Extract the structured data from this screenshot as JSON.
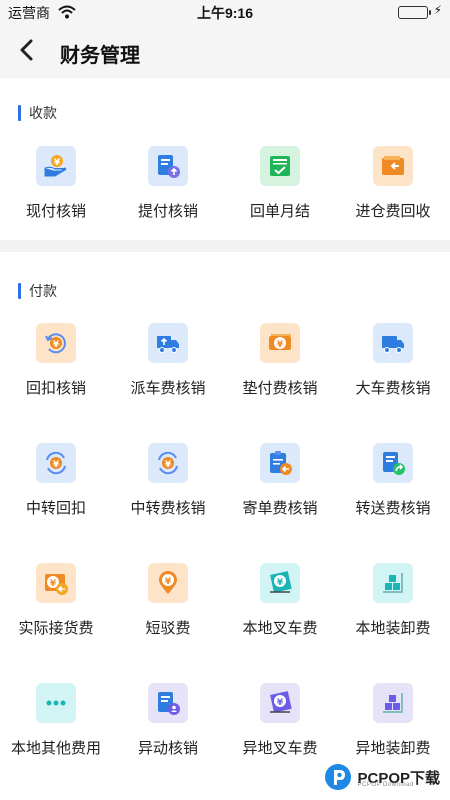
{
  "status_bar": {
    "carrier": "运营商",
    "time": "上午9:16",
    "wifi_icon": "wifi-icon",
    "battery_icon": "battery-icon",
    "battery_level": 1.0,
    "charging_icon": "charging-bolt-icon"
  },
  "nav": {
    "back_icon": "chevron-left-icon",
    "title": "财务管理"
  },
  "sections": [
    {
      "title": "收款",
      "items": [
        {
          "label": "现付核销",
          "icon": "cash-hand-icon",
          "color": "#2f7de1"
        },
        {
          "label": "提付核销",
          "icon": "document-upload-icon",
          "color": "#2f7de1"
        },
        {
          "label": "回单月结",
          "icon": "receipt-check-icon",
          "color": "#1fb65a"
        },
        {
          "label": "进仓费回收",
          "icon": "wallet-return-icon",
          "color": "#f08a24"
        }
      ]
    },
    {
      "title": "付款",
      "items": [
        {
          "label": "回扣核销",
          "icon": "yuan-cycle-icon",
          "color": "#f08a24"
        },
        {
          "label": "派车费核销",
          "icon": "truck-upload-icon",
          "color": "#2f7de1"
        },
        {
          "label": "垫付费核销",
          "icon": "money-stack-icon",
          "color": "#f08a24"
        },
        {
          "label": "大车费核销",
          "icon": "truck-icon",
          "color": "#2f7de1"
        },
        {
          "label": "中转回扣",
          "icon": "yuan-transfer-icon",
          "color": "#2f7de1"
        },
        {
          "label": "中转费核销",
          "icon": "yuan-transfer-icon",
          "color": "#2f7de1"
        },
        {
          "label": "寄单费核销",
          "icon": "clipboard-send-icon",
          "color": "#2f7de1"
        },
        {
          "label": "转送费核销",
          "icon": "document-forward-icon",
          "color": "#2f7de1"
        },
        {
          "label": "实际接货费",
          "icon": "wallet-yuan-icon",
          "color": "#f08a24"
        },
        {
          "label": "短驳费",
          "icon": "yuan-location-pin-icon",
          "color": "#f08a24"
        },
        {
          "label": "本地叉车费",
          "icon": "forklift-yuan-icon",
          "color": "#1bb5b5"
        },
        {
          "label": "本地装卸费",
          "icon": "boxes-cart-icon",
          "color": "#1bb5b5"
        },
        {
          "label": "本地其他费用",
          "icon": "more-dots-icon",
          "color": "#1bb5b5"
        },
        {
          "label": "异动核销",
          "icon": "document-user-icon",
          "color": "#6c5ce7"
        },
        {
          "label": "异地叉车费",
          "icon": "forklift-yuan-icon",
          "color": "#6c5ce7"
        },
        {
          "label": "异地装卸费",
          "icon": "boxes-cart-icon",
          "color": "#6c5ce7"
        }
      ]
    }
  ],
  "watermark": {
    "text": "PCPOP下载",
    "subtext": "PCPOP Download",
    "logo_icon": "pcpop-logo-icon"
  }
}
